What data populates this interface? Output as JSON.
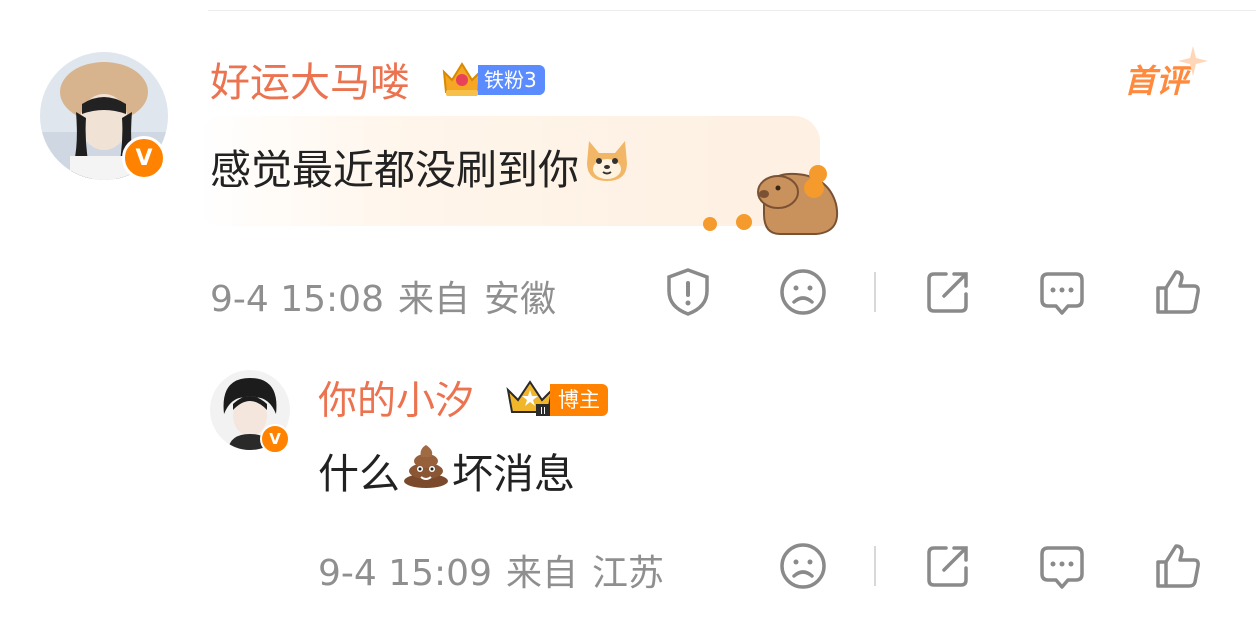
{
  "comment": {
    "username": "好运大马喽",
    "fan_badge": "铁粉3",
    "first_review_label": "首评",
    "text": "感觉最近都没刷到你",
    "date": "9-4 15:08",
    "source_prefix": "来自",
    "location": "安徽",
    "verified_mark": "V"
  },
  "reply": {
    "username": "你的小汐",
    "host_label": "博主",
    "text_before": "什么",
    "text_after": "坏消息",
    "date": "9-4 15:09",
    "source_prefix": "来自",
    "location": "江苏",
    "verified_mark": "V"
  },
  "icons": {
    "report": "report-shield-icon",
    "dislike": "sad-face-icon",
    "share": "share-icon",
    "reply": "comment-icon",
    "like": "thumbs-up-icon"
  },
  "colors": {
    "username": "#eb7350",
    "meta": "#8f8f8f",
    "badge_blue": "#5a8cff",
    "accent_orange": "#ff8200"
  }
}
